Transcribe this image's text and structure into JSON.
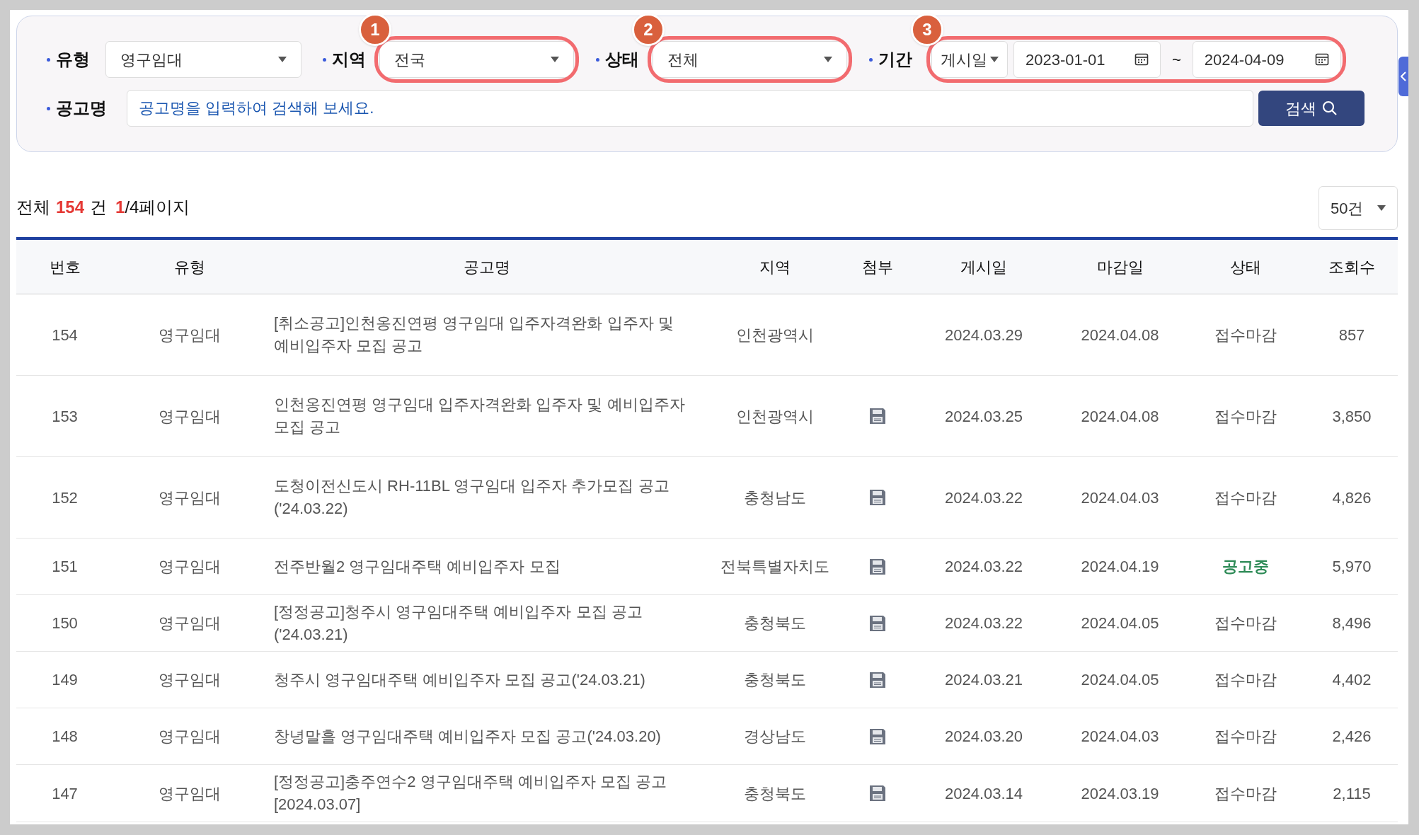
{
  "filters": {
    "type": {
      "label": "유형",
      "value": "영구임대"
    },
    "region": {
      "label": "지역",
      "value": "전국",
      "annotation": "1"
    },
    "status": {
      "label": "상태",
      "value": "전체",
      "annotation": "2"
    },
    "period": {
      "label": "기간",
      "basis": "게시일",
      "from": "2023-01-01",
      "separator": "~",
      "to": "2024-04-09",
      "annotation": "3"
    },
    "title": {
      "label": "공고명",
      "placeholder": "공고명을 입력하여 검색해 보세요."
    },
    "search_button": "검색"
  },
  "summary": {
    "prefix": "전체",
    "count": "154",
    "unit": "건",
    "page_current": "1",
    "page_rest": "/4페이지"
  },
  "page_size": "50건",
  "table": {
    "columns": [
      "번호",
      "유형",
      "공고명",
      "지역",
      "첨부",
      "게시일",
      "마감일",
      "상태",
      "조회수"
    ],
    "rows": [
      {
        "no": "154",
        "type": "영구임대",
        "title": "[취소공고]인천옹진연평 영구임대 입주자격완화 입주자 및 예비입주자 모집 공고",
        "region": "인천광역시",
        "attachment": false,
        "posted": "2024.03.29",
        "deadline": "2024.04.08",
        "status": "접수마감",
        "status_active": false,
        "views": "857"
      },
      {
        "no": "153",
        "type": "영구임대",
        "title": "인천옹진연평 영구임대 입주자격완화 입주자 및 예비입주자 모집 공고",
        "region": "인천광역시",
        "attachment": true,
        "posted": "2024.03.25",
        "deadline": "2024.04.08",
        "status": "접수마감",
        "status_active": false,
        "views": "3,850"
      },
      {
        "no": "152",
        "type": "영구임대",
        "title": "도청이전신도시 RH-11BL 영구임대 입주자 추가모집 공고 ('24.03.22)",
        "region": "충청남도",
        "attachment": true,
        "posted": "2024.03.22",
        "deadline": "2024.04.03",
        "status": "접수마감",
        "status_active": false,
        "views": "4,826"
      },
      {
        "no": "151",
        "type": "영구임대",
        "title": "전주반월2 영구임대주택 예비입주자 모집",
        "region": "전북특별자치도",
        "attachment": true,
        "posted": "2024.03.22",
        "deadline": "2024.04.19",
        "status": "공고중",
        "status_active": true,
        "views": "5,970"
      },
      {
        "no": "150",
        "type": "영구임대",
        "title": "[정정공고]청주시 영구임대주택 예비입주자 모집 공고('24.03.21)",
        "region": "충청북도",
        "attachment": true,
        "posted": "2024.03.22",
        "deadline": "2024.04.05",
        "status": "접수마감",
        "status_active": false,
        "views": "8,496"
      },
      {
        "no": "149",
        "type": "영구임대",
        "title": "청주시 영구임대주택 예비입주자 모집 공고('24.03.21)",
        "region": "충청북도",
        "attachment": true,
        "posted": "2024.03.21",
        "deadline": "2024.04.05",
        "status": "접수마감",
        "status_active": false,
        "views": "4,402"
      },
      {
        "no": "148",
        "type": "영구임대",
        "title": "창녕말흘 영구임대주택 예비입주자 모집 공고('24.03.20)",
        "region": "경상남도",
        "attachment": true,
        "posted": "2024.03.20",
        "deadline": "2024.04.03",
        "status": "접수마감",
        "status_active": false,
        "views": "2,426"
      },
      {
        "no": "147",
        "type": "영구임대",
        "title": "[정정공고]충주연수2 영구임대주택 예비입주자 모집 공고 [2024.03.07]",
        "region": "충청북도",
        "attachment": true,
        "posted": "2024.03.14",
        "deadline": "2024.03.19",
        "status": "접수마감",
        "status_active": false,
        "views": "2,115"
      }
    ]
  }
}
